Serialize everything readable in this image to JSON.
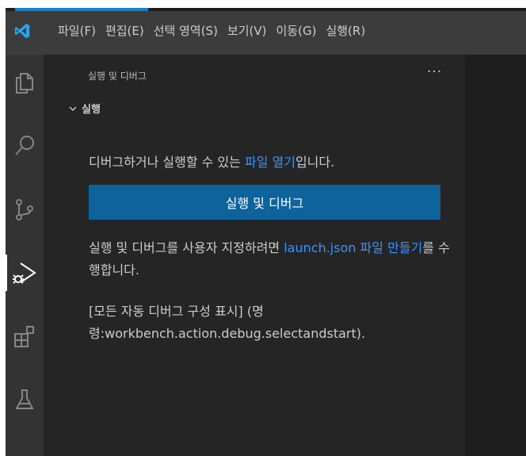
{
  "menubar": {
    "items": [
      {
        "label": "파일(F)"
      },
      {
        "label": "편집(E)"
      },
      {
        "label": "선택 영역(S)"
      },
      {
        "label": "보기(V)"
      },
      {
        "label": "이동(G)"
      },
      {
        "label": "실행(R)"
      }
    ]
  },
  "activitybar": {
    "icons": [
      "explorer-icon",
      "search-icon",
      "source-control-icon",
      "run-debug-icon",
      "extensions-icon",
      "testing-icon"
    ],
    "active": "run-debug-icon"
  },
  "sidebar": {
    "title": "실행 및 디버그",
    "more_label": "···",
    "section": {
      "title": "실행",
      "open_file_prefix": "디버그하거나 실행할 수 있는 ",
      "open_file_link": "파일 열기",
      "open_file_suffix": "입니다.",
      "run_button_label": "실행 및 디버그",
      "launch_prefix": "실행 및 디버그를 사용자 지정하려면 ",
      "launch_link": "launch.json 파일 만들기",
      "launch_suffix": "를 수행합니다.",
      "config_text": "[모든 자동 디버그 구성 표시] (명령:workbench.action.debug.selectandstart)."
    }
  },
  "colors": {
    "titlebar": "#3c3c3c",
    "activitybar": "#333333",
    "sidebar": "#252526",
    "editor": "#1e1e1e",
    "button": "#0e639c",
    "link": "#3794ff",
    "logo": "#23a9f2"
  }
}
